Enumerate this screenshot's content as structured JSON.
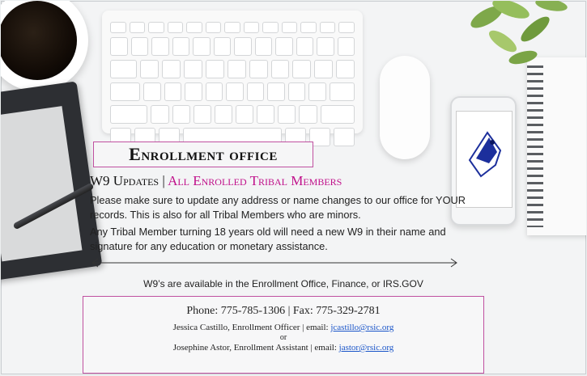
{
  "flyer": {
    "title": "Enrollment office",
    "headline": {
      "part1": "W9 Updates | ",
      "part2": "All Enrolled Tribal Members"
    },
    "paragraph1": "Please make sure to update any address or name changes to our office for YOUR records. This is also for all Tribal Members who are minors.",
    "paragraph2": "Any Tribal Member turning 18 years old will need a new W9 in their name and signature for any education or monetary assistance.",
    "availability": "W9’s are available in the Enrollment Office, Finance, or IRS.GOV"
  },
  "contact": {
    "phone_line": "Phone: 775-785-1306 | Fax: 775-329-2781",
    "person1_text": "Jessica Castillo, Enrollment Officer | email: ",
    "person1_email": "jcastillo@rsic.org",
    "or_text": "or",
    "person2_text": "Josephine Astor, Enrollment Assistant | email: ",
    "person2_email": "jastor@rsic.org"
  },
  "colors": {
    "accent": "#c0108a",
    "border": "#c050a0",
    "link": "#1a55c9"
  },
  "icons": [
    "coffee-cup-icon",
    "keyboard-icon",
    "mouse-icon",
    "phone-icon",
    "tablet-icon",
    "notebook-icon",
    "plant-icon",
    "double-arrow-icon"
  ]
}
